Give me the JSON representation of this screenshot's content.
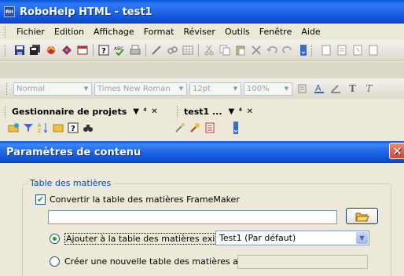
{
  "window": {
    "title": "RoboHelp HTML - test1",
    "icon": "RH"
  },
  "menu": [
    "Fichier",
    "Edition",
    "Affichage",
    "Format",
    "Réviser",
    "Outils",
    "Fenêtre",
    "Aide"
  ],
  "toolbar": {
    "icons": [
      "save-icon",
      "save-all-icon",
      "compile-icon",
      "view-icon",
      "window-icon",
      "help-icon",
      "spell-icon",
      "print-icon",
      "pen-icon",
      "link-icon",
      "table-icon",
      "cut-icon",
      "copy-icon",
      "paste-icon",
      "delete-icon",
      "undo-icon",
      "redo-icon"
    ]
  },
  "format_bar": {
    "style": "Normal",
    "font": "Times New Roman",
    "size": "12pt",
    "zoom": "100%",
    "bold_glyph": "T",
    "italic_glyph": "T"
  },
  "panes": {
    "project_manager": "Gestionnaire de projets",
    "doc_tab": "test1 ...",
    "pin_glyph": "▼ ⁴ ✕"
  },
  "dialog": {
    "title": "Paramètres de contenu",
    "close": "✕",
    "group_label": "Table des matières",
    "convert_label": "Convertir la table des matières FrameMaker",
    "convert_checked": true,
    "path_value": "",
    "add_label": "Ajouter à la table des matières existante",
    "add_selected": true,
    "toc_selected": "Test1 (Par défaut)",
    "create_label": "Créer une nouvelle table des matières associée",
    "create_selected": false,
    "new_toc_value": ""
  },
  "colors": {
    "title_blue": "#0b4fd1",
    "group_label": "#0046d5",
    "check_green": "#21a121",
    "close_red": "#d8442a"
  }
}
